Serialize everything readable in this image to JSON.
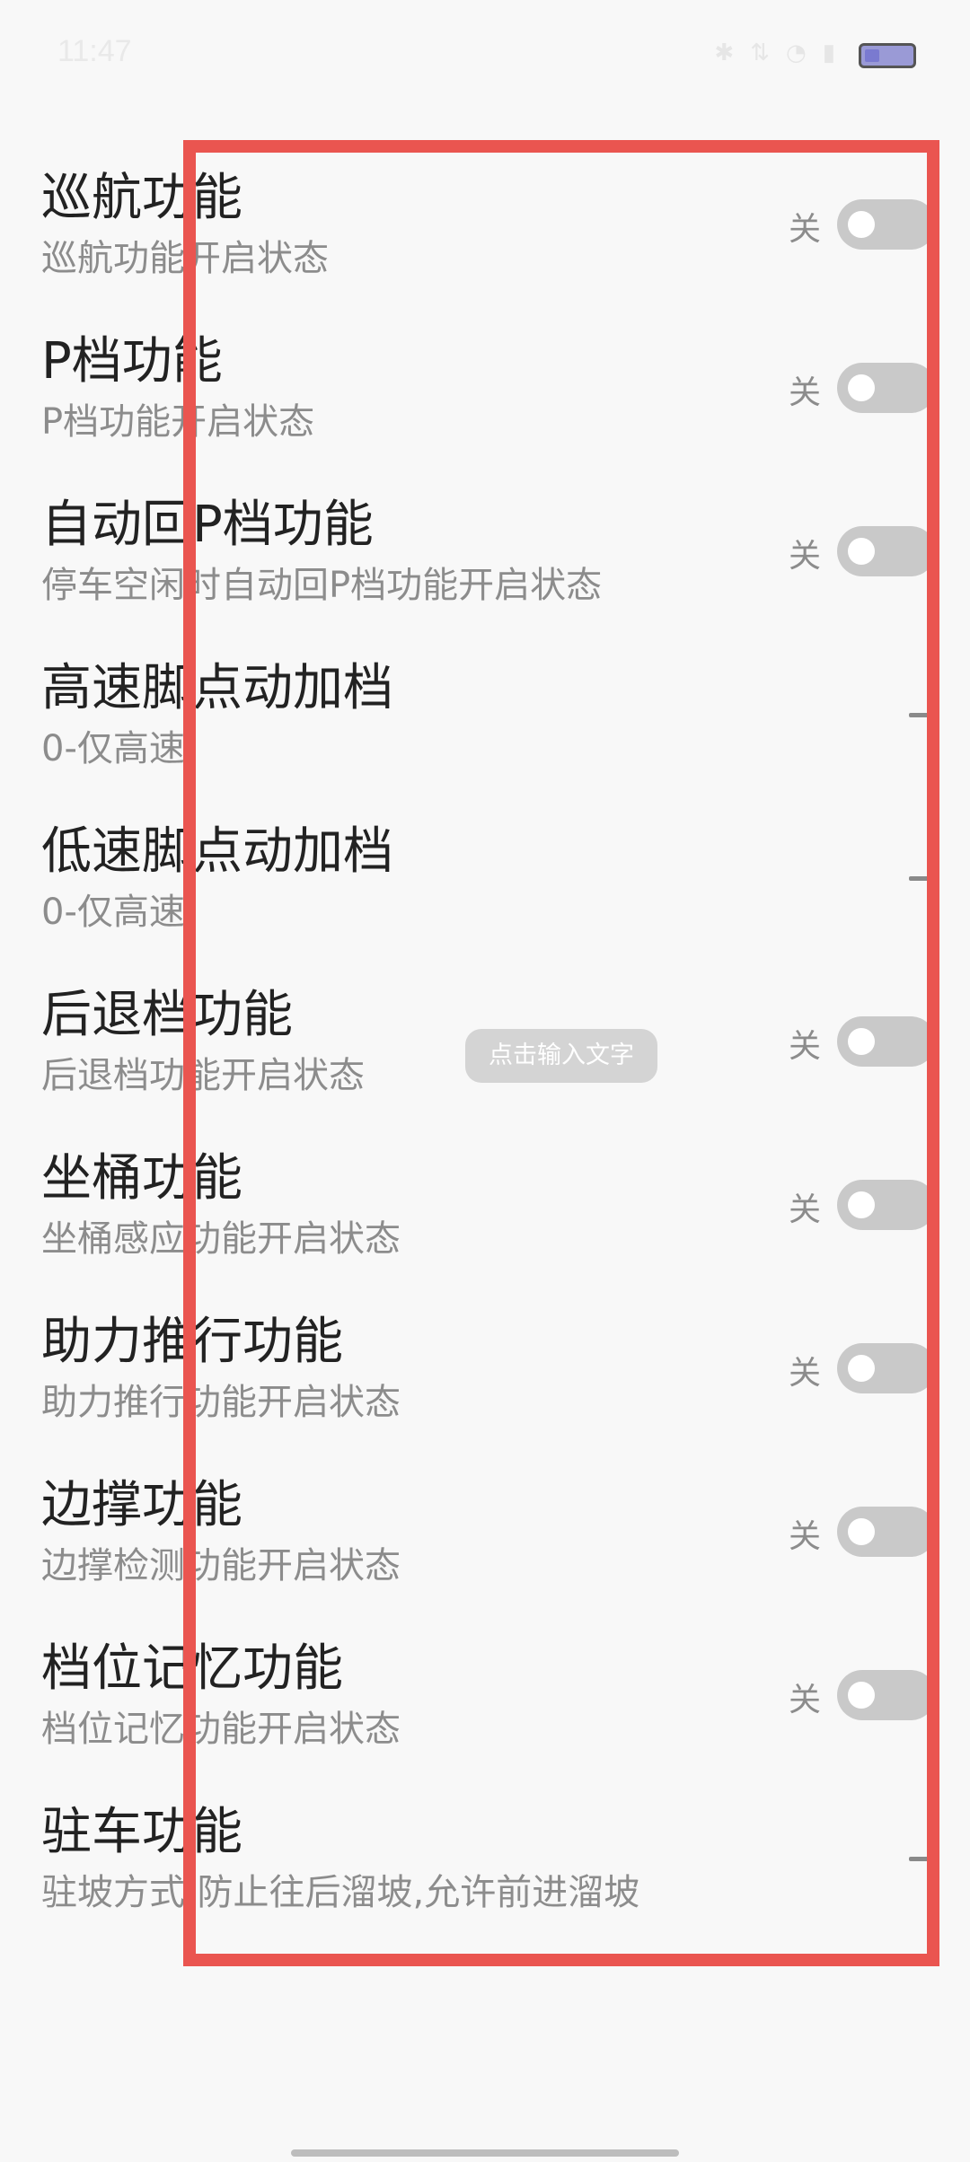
{
  "status_bar": {
    "time": "11:47",
    "icons": [
      "bluetooth-icon",
      "data-icon",
      "wifi-icon",
      "signal-icon"
    ]
  },
  "rows": [
    {
      "title": "巡航功能",
      "subtitle": "巡航功能开启状态",
      "control": "toggle",
      "state_label": "关",
      "on": false
    },
    {
      "title": "P档功能",
      "subtitle": "P档功能开启状态",
      "control": "toggle",
      "state_label": "关",
      "on": false
    },
    {
      "title": "自动回P档功能",
      "subtitle": "停车空闲时自动回P档功能开启状态",
      "control": "toggle",
      "state_label": "关",
      "on": false
    },
    {
      "title": "高速脚点动加档",
      "subtitle": "0-仅高速",
      "control": "dropdown"
    },
    {
      "title": "低速脚点动加档",
      "subtitle": "0-仅高速",
      "control": "dropdown"
    },
    {
      "title": "后退档功能",
      "subtitle": "后退档功能开启状态",
      "control": "toggle",
      "state_label": "关",
      "on": false
    },
    {
      "title": "坐桶功能",
      "subtitle": "坐桶感应功能开启状态",
      "control": "toggle",
      "state_label": "关",
      "on": false
    },
    {
      "title": "助力推行功能",
      "subtitle": "助力推行功能开启状态",
      "control": "toggle",
      "state_label": "关",
      "on": false
    },
    {
      "title": "边撑功能",
      "subtitle": "边撑检测功能开启状态",
      "control": "toggle",
      "state_label": "关",
      "on": false
    },
    {
      "title": "档位记忆功能",
      "subtitle": "档位记忆功能开启状态",
      "control": "toggle",
      "state_label": "关",
      "on": false
    },
    {
      "title": "驻车功能",
      "subtitle": "驻坡方式:防止往后溜坡,允许前进溜坡",
      "control": "dropdown"
    }
  ],
  "overlay": {
    "input_hint": "点击输入文字",
    "highlight_color": "#ea5550"
  }
}
